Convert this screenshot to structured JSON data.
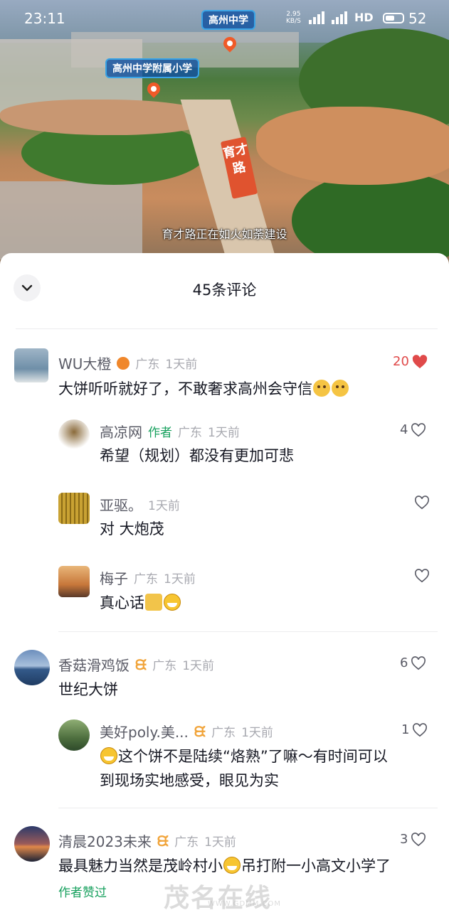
{
  "status_bar": {
    "time": "23:11",
    "net_speed": "2.95",
    "net_unit": "KB/S",
    "network": "HD",
    "battery": "52"
  },
  "video": {
    "tag_school": "高州中学",
    "tag_primary": "高州中学附属小学",
    "road_label": "育才路",
    "caption": "育才路正在如火如荼建设"
  },
  "comments_header": {
    "title": "45条评论"
  },
  "comments": [
    {
      "name": "WU大橙",
      "location": "广东",
      "time": "1天前",
      "text": "大饼听听就好了，不敢奢求高州会守信",
      "likes": "20",
      "liked": true,
      "replies": [
        {
          "name": "高凉网",
          "author_tag": "作者",
          "location": "广东",
          "time": "1天前",
          "text": "希望（规划）都没有更加可悲",
          "likes": "4"
        },
        {
          "name": "亚驱。",
          "location": "",
          "time": "1天前",
          "text": "对 大炮茂",
          "likes": ""
        },
        {
          "name": "梅子",
          "location": "广东",
          "time": "1天前",
          "text": "真心话",
          "likes": ""
        }
      ]
    },
    {
      "name": "香菇滑鸡饭",
      "location": "广东",
      "time": "1天前",
      "text": "世纪大饼",
      "likes": "6",
      "replies": [
        {
          "name": "美好poly.美...",
          "location": "广东",
          "time": "1天前",
          "text_line1": "这个饼不是陆续“烙熟”了嘛～有时间可以",
          "text_line2": "到现场实地感受，眼见为实",
          "likes": "1"
        }
      ]
    },
    {
      "name": "清晨2023未来",
      "location": "广东",
      "time": "1天前",
      "text_before": "最具魅力当然是茂岭村小",
      "text_after": "吊打附一小高文小学了",
      "likes": "3",
      "author_liked": "作者赞过"
    }
  ],
  "watermark": {
    "text": "茂名在线",
    "url": "WWW.GDMM.COM"
  },
  "colors": {
    "like_red": "#e04a4a",
    "author_green": "#16a05d",
    "meta_gray": "#a8a9b0"
  }
}
